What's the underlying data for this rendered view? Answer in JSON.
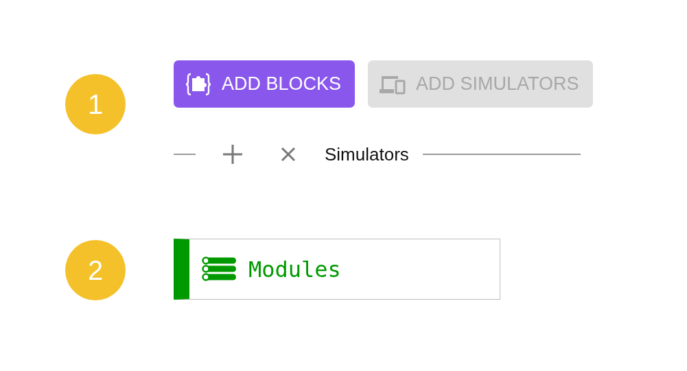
{
  "steps": [
    {
      "number": "1",
      "buttons": [
        {
          "label": "ADD BLOCKS",
          "kind": "blocks",
          "disabled": false
        },
        {
          "label": "ADD SIMULATORS",
          "kind": "simulators",
          "disabled": true
        }
      ],
      "toolbar": {
        "label": "Simulators"
      }
    },
    {
      "number": "2",
      "block": {
        "label": "Modules"
      }
    }
  ]
}
